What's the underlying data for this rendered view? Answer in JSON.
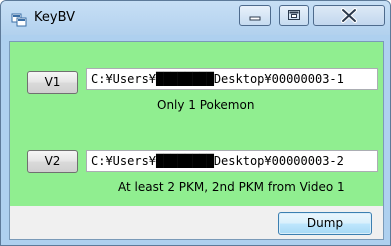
{
  "window": {
    "title": "KeyBV",
    "app_icon": "keybv-app-icon",
    "controls": [
      "minimize-icon",
      "maximize-icon",
      "close-icon"
    ]
  },
  "v1": {
    "button_label": "V1",
    "path_value": "C:¥Users¥████████Desktop¥00000003-1",
    "description": "Only 1 Pokemon"
  },
  "v2": {
    "button_label": "V2",
    "path_value": "C:¥Users¥████████Desktop¥00000003-2",
    "description": "At least 2 PKM, 2nd PKM from Video 1"
  },
  "footer": {
    "dump_label": "Dump"
  },
  "colors": {
    "client_background": "#90ee90",
    "footer_background": "#f0f0f0",
    "titlebar": "#b9d5f0"
  }
}
